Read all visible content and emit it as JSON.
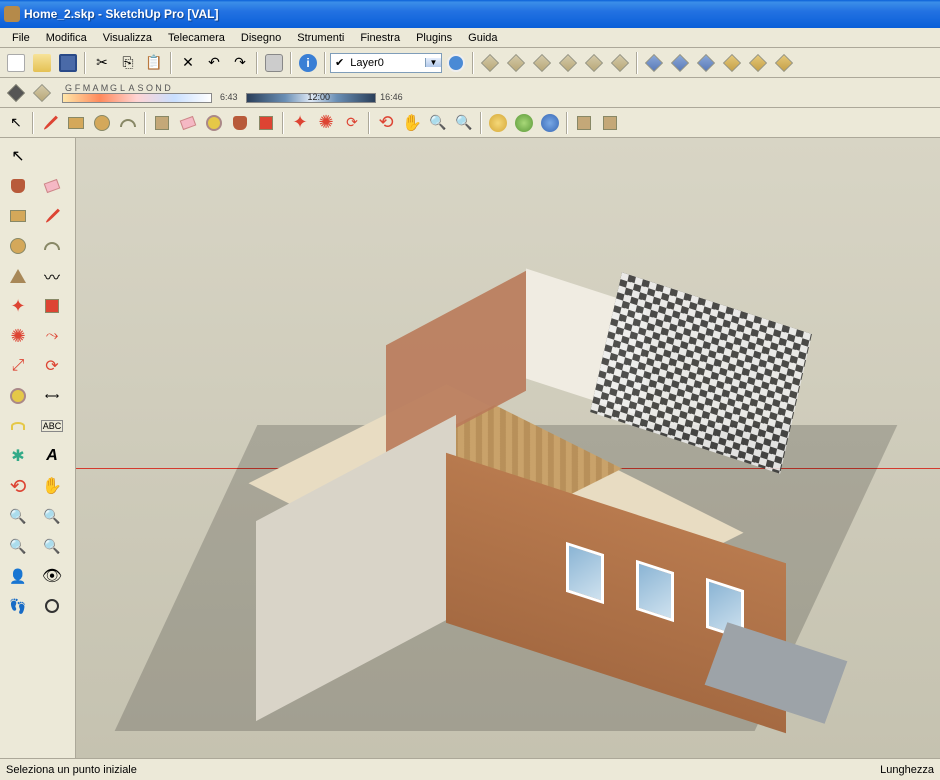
{
  "window": {
    "title": "Home_2.skp - SketchUp Pro [VAL]"
  },
  "menu": {
    "file": "File",
    "modifica": "Modifica",
    "visualizza": "Visualizza",
    "telecamera": "Telecamera",
    "disegno": "Disegno",
    "strumenti": "Strumenti",
    "finestra": "Finestra",
    "plugins": "Plugins",
    "guida": "Guida"
  },
  "layer": {
    "selected": "Layer0"
  },
  "shadow": {
    "months": [
      "G",
      "F",
      "M",
      "A",
      "M",
      "G",
      "L",
      "A",
      "S",
      "O",
      "N",
      "D"
    ],
    "date_value": "6:43",
    "time_noon": "12:00",
    "time_end": "16:46"
  },
  "status": {
    "hint": "Seleziona un punto iniziale",
    "right": "Lunghezza"
  },
  "icons": {
    "new": "new-file-icon",
    "open": "open-icon",
    "save": "save-icon",
    "cut": "cut-icon",
    "copy": "copy-icon",
    "paste": "paste-icon",
    "erase": "erase-icon",
    "undo": "undo-icon",
    "redo": "redo-icon",
    "print": "print-icon",
    "info": "model-info-icon",
    "layer_mgr": "layer-manager-icon",
    "iso": "iso-view-icon",
    "top": "top-view-icon",
    "front": "front-view-icon",
    "right": "right-view-icon",
    "back": "back-view-icon",
    "left": "left-view-icon",
    "style_wire": "wireframe-icon",
    "style_hidden": "hiddenline-icon",
    "style_shaded": "shaded-icon",
    "style_tex": "shaded-textures-icon",
    "style_mono": "monochrome-icon",
    "shadow_toggle": "shadow-toggle-icon",
    "shadow_settings": "shadow-settings-icon",
    "select": "select-tool-icon",
    "line": "line-tool-icon",
    "rect": "rectangle-tool-icon",
    "circle": "circle-tool-icon",
    "arc": "arc-tool-icon",
    "freehand": "freehand-tool-icon",
    "eraser": "eraser-tool-icon",
    "tape": "tape-measure-icon",
    "paint": "paint-bucket-icon",
    "pushpull": "pushpull-tool-icon",
    "move": "move-tool-icon",
    "rotate": "rotate-tool-icon",
    "scale": "scale-tool-icon",
    "offset": "offset-tool-icon",
    "orbit": "orbit-tool-icon",
    "pan": "pan-tool-icon",
    "zoom": "zoom-tool-icon",
    "zoom_window": "zoom-window-icon",
    "zoom_extents": "zoom-extents-icon",
    "prev_view": "previous-view-icon",
    "next_view": "next-view-icon",
    "position_camera": "position-camera-icon",
    "walk": "walk-tool-icon",
    "look": "look-around-icon",
    "section": "section-plane-icon",
    "axes": "axes-tool-icon",
    "dimension": "dimension-tool-icon",
    "text": "text-tool-icon",
    "3dtext": "3d-text-tool-icon",
    "protractor": "protractor-icon",
    "followme": "followme-tool-icon",
    "polygon": "polygon-tool-icon",
    "component": "make-component-icon",
    "outliner": "outliner-icon",
    "google_earth": "google-earth-icon",
    "get_models": "get-models-icon",
    "share_model": "share-model-icon",
    "3dwh": "3dwarehouse-icon"
  }
}
